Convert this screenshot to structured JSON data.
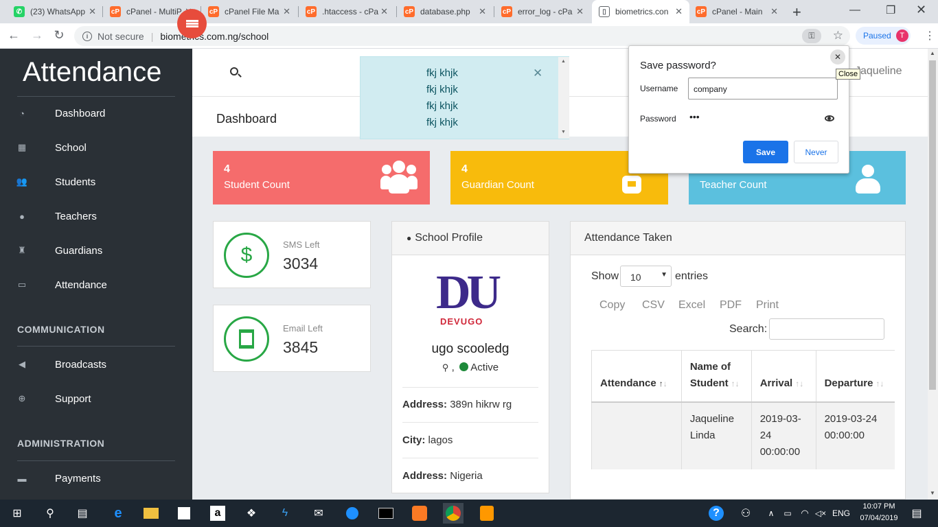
{
  "browser": {
    "tabs": [
      {
        "label": "(23) WhatsApp",
        "icon": "whatsapp-icon",
        "color": "#25d366",
        "glyph": "✆"
      },
      {
        "label": "cPanel - MultiP",
        "icon": "cpanel-icon",
        "color": "#ff6c2c",
        "glyph": "cP"
      },
      {
        "label": "cPanel File Ma",
        "icon": "cpanel-icon",
        "color": "#ff6c2c",
        "glyph": "cP"
      },
      {
        "label": ".htaccess - cPa",
        "icon": "cpanel-icon",
        "color": "#ff6c2c",
        "glyph": "cP"
      },
      {
        "label": "database.php",
        "icon": "cpanel-icon",
        "color": "#ff6c2c",
        "glyph": "cP"
      },
      {
        "label": "error_log - cPa",
        "icon": "cpanel-icon",
        "color": "#ff6c2c",
        "glyph": "cP"
      },
      {
        "label": "biometrics.con",
        "icon": "page-icon",
        "color": "#ffffff",
        "glyph": "▯"
      },
      {
        "label": "cPanel - Main",
        "icon": "cpanel-icon",
        "color": "#ff6c2c",
        "glyph": "cP"
      }
    ],
    "security_label": "Not secure",
    "url": "biometrics.com.ng/school",
    "profile_status": "Paused",
    "profile_initial": "T"
  },
  "sidebar": {
    "brand": "Attendance",
    "items": [
      {
        "label": "Dashboard",
        "icon": "dashboard-icon",
        "glyph": "◔"
      },
      {
        "label": "School",
        "icon": "building-icon",
        "glyph": "▦"
      },
      {
        "label": "Students",
        "icon": "users-icon",
        "glyph": "👥"
      },
      {
        "label": "Teachers",
        "icon": "user-icon",
        "glyph": "●"
      },
      {
        "label": "Guardians",
        "icon": "guardian-icon",
        "glyph": "♜"
      },
      {
        "label": "Attendance",
        "icon": "laptop-icon",
        "glyph": "▭"
      }
    ],
    "section_communication": "COMMUNICATION",
    "comm_items": [
      {
        "label": "Broadcasts",
        "icon": "bullhorn-icon",
        "glyph": "◀"
      },
      {
        "label": "Support",
        "icon": "lifebuoy-icon",
        "glyph": "⊕"
      }
    ],
    "section_administration": "ADMINISTRATION",
    "admin_items": [
      {
        "label": "Payments",
        "icon": "credit-card-icon",
        "glyph": "▬"
      }
    ]
  },
  "header": {
    "user_name": "Jaqueline",
    "page_title": "Dashboard"
  },
  "alert": {
    "lines": [
      "fkj khjk",
      "fkj khjk",
      "fkj khjk",
      "fkj khjk"
    ]
  },
  "stats": [
    {
      "value": "4",
      "label": "Student Count",
      "color": "#f56c6c"
    },
    {
      "value": "4",
      "label": "Guardian Count",
      "color": "#f8bb0c"
    },
    {
      "value": "",
      "label": "Teacher Count",
      "color": "#5bc0de"
    }
  ],
  "sms": {
    "label": "SMS Left",
    "value": "3034"
  },
  "email": {
    "label": "Email Left",
    "value": "3845"
  },
  "profile": {
    "title": "School Profile",
    "logo_text": "DU",
    "logo_sub": "DEVUGO",
    "name": "ugo scooledg",
    "location_sep": ",",
    "status": "Active",
    "rows": [
      {
        "key": "Address:",
        "value": "389n hikrw rg"
      },
      {
        "key": "City:",
        "value": "lagos"
      },
      {
        "key": "Address:",
        "value": "Nigeria"
      }
    ]
  },
  "attendance": {
    "title": "Attendance Taken",
    "show_label": "Show",
    "entries_value": "10",
    "entries_label": "entries",
    "buttons": [
      "Copy",
      "CSV",
      "Excel",
      "PDF",
      "Print"
    ],
    "search_label": "Search:",
    "columns": [
      "Attendance",
      "Name of Student",
      "Arrival",
      "Departure"
    ],
    "rows": [
      {
        "attendance": "",
        "name": "Jaqueline Linda",
        "arrival": "2019-03-24 00:00:00",
        "departure": "2019-03-24 00:00:00"
      }
    ]
  },
  "password_bubble": {
    "title": "Save password?",
    "username_label": "Username",
    "username_value": "company",
    "password_label": "Password",
    "password_value": "•••",
    "save_label": "Save",
    "never_label": "Never",
    "close_tooltip": "Close"
  },
  "taskbar": {
    "language": "ENG",
    "time": "10:07 PM",
    "date": "07/04/2019"
  }
}
